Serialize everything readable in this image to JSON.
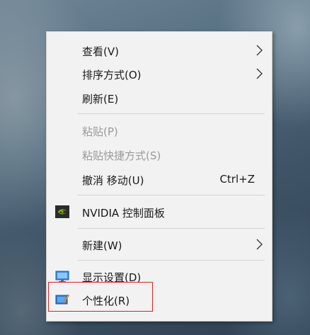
{
  "context_menu": {
    "items": [
      {
        "label": "查看(V)",
        "submenu": true
      },
      {
        "label": "排序方式(O)",
        "submenu": true
      },
      {
        "label": "刷新(E)"
      },
      {
        "label": "粘贴(P)",
        "disabled": true
      },
      {
        "label": "粘贴快捷方式(S)",
        "disabled": true
      },
      {
        "label": "撤消 移动(U)",
        "shortcut": "Ctrl+Z"
      },
      {
        "label": "NVIDIA 控制面板",
        "icon": "nvidia-icon"
      },
      {
        "label": "新建(W)",
        "submenu": true
      },
      {
        "label": "显示设置(D)",
        "icon": "display-settings-icon"
      },
      {
        "label": "个性化(R)",
        "icon": "personalize-icon"
      }
    ]
  },
  "colors": {
    "menu_background": "#f2f2f2",
    "disabled_text": "#9a9a9a",
    "highlight_border": "#e02020",
    "nvidia_green": "#76b900"
  }
}
